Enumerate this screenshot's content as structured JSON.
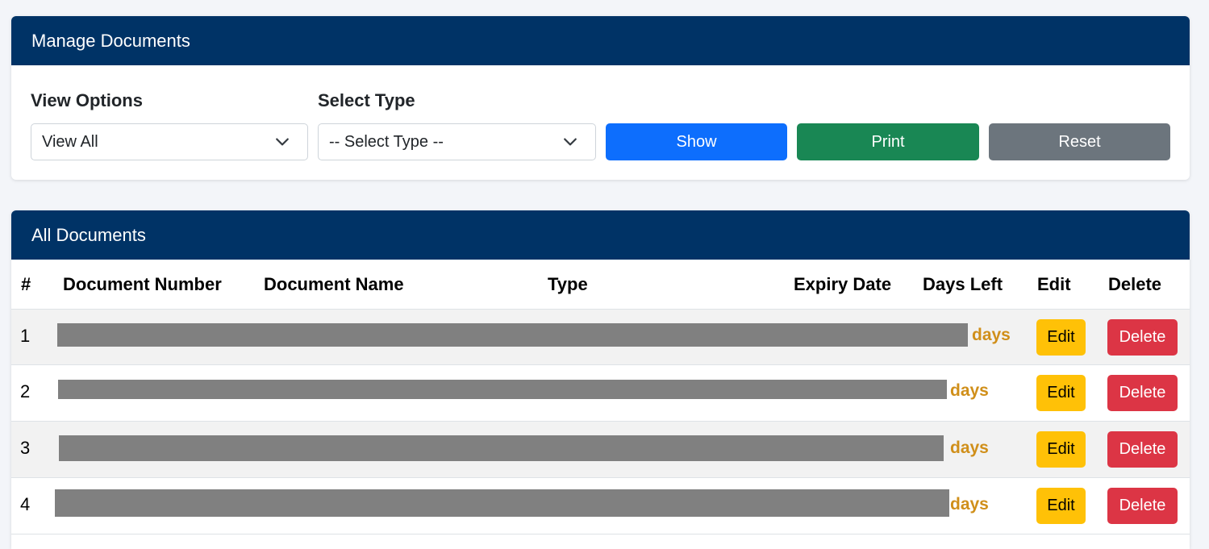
{
  "manage": {
    "title": "Manage Documents",
    "view_options_label": "View Options",
    "view_options_value": "View All",
    "select_type_label": "Select Type",
    "select_type_value": "-- Select Type --",
    "show_label": "Show",
    "print_label": "Print",
    "reset_label": "Reset"
  },
  "colors": {
    "header": "#003366",
    "show": "#0d6efd",
    "print": "#198754",
    "reset": "#6c757d",
    "edit": "#ffc107",
    "delete": "#dc3545",
    "days": "#d08f1a"
  },
  "documents": {
    "title": "All Documents",
    "columns": [
      "#",
      "Document Number",
      "Document Name",
      "Type",
      "Expiry Date",
      "Days Left",
      "Edit",
      "Delete"
    ],
    "rows": [
      {
        "num": "1",
        "days": "days",
        "edit": "Edit",
        "delete": "Delete"
      },
      {
        "num": "2",
        "days": "days",
        "edit": "Edit",
        "delete": "Delete"
      },
      {
        "num": "3",
        "days": "days",
        "edit": "Edit",
        "delete": "Delete"
      },
      {
        "num": "4",
        "days": "days",
        "edit": "Edit",
        "delete": "Delete"
      }
    ]
  }
}
